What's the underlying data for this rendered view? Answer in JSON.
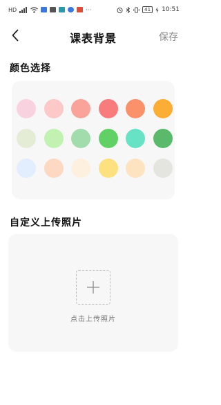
{
  "status_bar": {
    "bluetooth_icon": "bluetooth-icon",
    "battery": "41",
    "time": "10:51"
  },
  "header": {
    "title": "课表背景",
    "save_label": "保存"
  },
  "colors_section": {
    "title": "颜色选择",
    "swatches": [
      [
        "#f8d3df",
        "#fcc8c8",
        "#f9a39a",
        "#f87c7c",
        "#fa916b",
        "#fbad36"
      ],
      [
        "#e5ecd6",
        "#c2f2b2",
        "#a3dcac",
        "#62d165",
        "#68e2c4",
        "#5ab96a"
      ],
      [
        "#e2edfd",
        "#fdd8c3",
        "#fdf0de",
        "#fee17f",
        "#fde3c0",
        "#e5e5e0"
      ]
    ]
  },
  "custom_section": {
    "title": "自定义上传照片",
    "upload_hint": "点击上传照片"
  }
}
